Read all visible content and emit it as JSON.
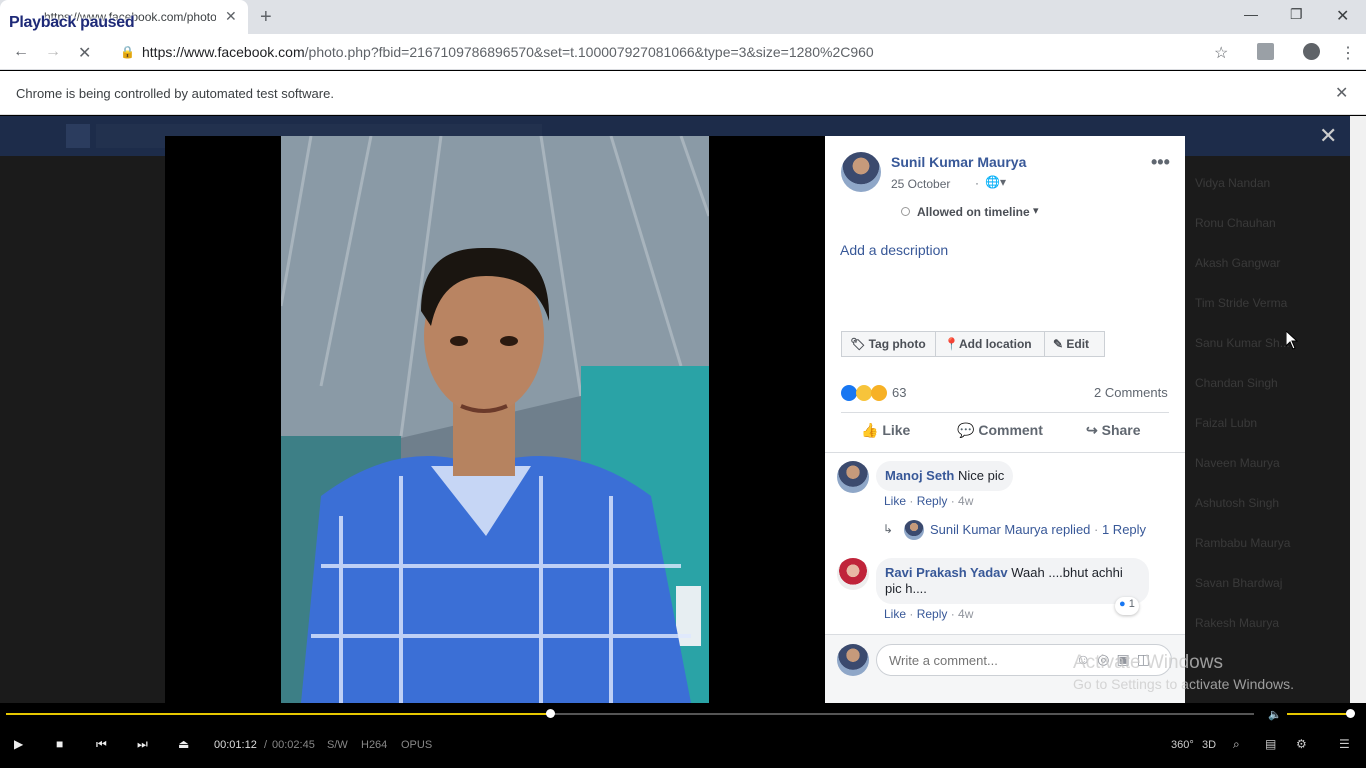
{
  "browser": {
    "tab_title": "https://www.facebook.com/photo",
    "overlay_label": "Playback paused",
    "url_host": "https://www.facebook.com",
    "url_path": "/photo.php?fbid=2167109786896570&set=t.100007927081066&type=3&size=1280%2C960",
    "infobar_text": "Chrome is being controlled by automated test software."
  },
  "background_names": [
    "Vidya Nandan",
    "Ronu Chauhan",
    "Akash Gangwar",
    "Tim Stride Verma",
    "Sanu Kumar Sh...",
    "Chandan Singh",
    "Faizal Lubn",
    "Naveen Maurya",
    "Ashutosh Singh",
    "Rambabu Maurya",
    "Savan Bhardwaj",
    "Rakesh Maurya"
  ],
  "post": {
    "author": "Sunil Kumar Maurya",
    "date": "25 October",
    "privacy_dot": "·",
    "timeline_status": "Allowed on timeline",
    "add_description": "Add a description",
    "buttons": {
      "tag": "Tag photo",
      "location": "Add location",
      "edit": "Edit"
    },
    "reaction_count": "63",
    "comments_count": "2 Comments",
    "actions": {
      "like": "Like",
      "comment": "Comment",
      "share": "Share"
    }
  },
  "comments": [
    {
      "author": "Manoj Seth",
      "text": "Nice pic",
      "like": "Like",
      "reply": "Reply",
      "age": "4w",
      "reply_summary": {
        "author": "Sunil Kumar Maurya replied",
        "count": "1 Reply"
      }
    },
    {
      "author": "Ravi Prakash Yadav",
      "text": "Waah ....bhut achhi pic h....",
      "like": "Like",
      "reply": "Reply",
      "age": "4w",
      "likes": "1"
    }
  ],
  "composer": {
    "placeholder": "Write a comment..."
  },
  "watermark": {
    "line1": "Activate Windows",
    "line2": "Go to Settings to activate Windows."
  },
  "player": {
    "current_time": "00:01:12",
    "separator": "/",
    "total_time": "00:02:45",
    "tags": [
      "S/W",
      "H264",
      "OPUS"
    ],
    "progress": 0.436,
    "volume": 1.0,
    "right_labels": [
      "360°",
      "3D"
    ]
  }
}
